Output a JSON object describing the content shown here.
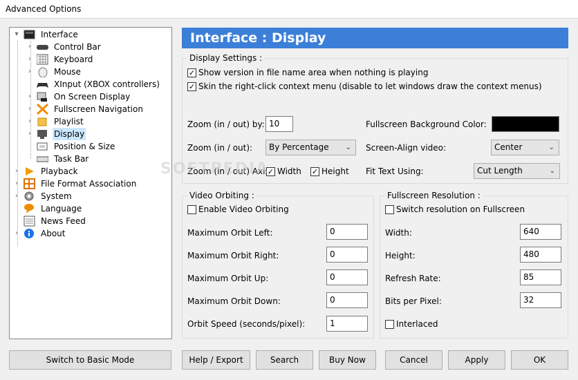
{
  "window": {
    "title": "Advanced Options"
  },
  "tree": [
    {
      "label": "Interface",
      "icon": "interface-icon",
      "expanded": true
    },
    {
      "label": "Control Bar",
      "icon": "control-bar-icon"
    },
    {
      "label": "Keyboard",
      "icon": "keyboard-icon"
    },
    {
      "label": "Mouse",
      "icon": "mouse-icon"
    },
    {
      "label": "XInput (XBOX controllers)",
      "icon": "gamepad-icon"
    },
    {
      "label": "On Screen Display",
      "icon": "osd-icon"
    },
    {
      "label": "Fullscreen Navigation",
      "icon": "fullscreen-nav-icon"
    },
    {
      "label": "Playlist",
      "icon": "playlist-icon"
    },
    {
      "label": "Display",
      "icon": "display-icon",
      "selected": true
    },
    {
      "label": "Position & Size",
      "icon": "position-size-icon"
    },
    {
      "label": "Task Bar",
      "icon": "taskbar-icon"
    },
    {
      "label": "Playback",
      "icon": "playback-icon"
    },
    {
      "label": "File Format Association",
      "icon": "file-format-icon"
    },
    {
      "label": "System",
      "icon": "gear-icon"
    },
    {
      "label": "Language",
      "icon": "language-icon"
    },
    {
      "label": "News Feed",
      "icon": "news-icon"
    },
    {
      "label": "About",
      "icon": "info-icon"
    }
  ],
  "header": {
    "title": "Interface : Display"
  },
  "display_settings": {
    "title": "Display Settings :",
    "show_version": {
      "label": "Show version in file name area when nothing is playing",
      "checked": true
    },
    "skin_context": {
      "label": "Skin the right-click context menu (disable to let windows draw the context menus)",
      "checked": true
    },
    "zoom_by_label": "Zoom (in / out) by:",
    "zoom_by_value": "10",
    "zoom_mode_label": "Zoom (in / out):",
    "zoom_mode_value": "By Percentage",
    "zoom_axis_label": "Zoom (in / out) Axis:",
    "axis_width": {
      "label": "Width",
      "checked": true
    },
    "axis_height": {
      "label": "Height",
      "checked": true
    },
    "bg_color_label": "Fullscreen Background Color:",
    "bg_color_value": "#000000",
    "align_label": "Screen-Align video:",
    "align_value": "Center",
    "fit_text_label": "Fit Text Using:",
    "fit_text_value": "Cut Length"
  },
  "video_orbiting": {
    "title": "Video Orbiting :",
    "enable": {
      "label": "Enable Video Orbiting",
      "checked": false
    },
    "fields": [
      {
        "label": "Maximum Orbit Left:",
        "value": "0"
      },
      {
        "label": "Maximum Orbit Right:",
        "value": "0"
      },
      {
        "label": "Maximum Orbit Up:",
        "value": "0"
      },
      {
        "label": "Maximum Orbit Down:",
        "value": "0"
      },
      {
        "label": "Orbit Speed (seconds/pixel):",
        "value": "1"
      }
    ]
  },
  "fullscreen_resolution": {
    "title": "Fullscreen Resolution :",
    "switch": {
      "label": "Switch resolution on Fullscreen",
      "checked": false
    },
    "fields": [
      {
        "label": "Width:",
        "value": "640"
      },
      {
        "label": "Height:",
        "value": "480"
      },
      {
        "label": "Refresh Rate:",
        "value": "85"
      },
      {
        "label": "Bits per Pixel:",
        "value": "32"
      }
    ],
    "interlaced": {
      "label": "Interlaced",
      "checked": false
    }
  },
  "buttons": {
    "basic_mode": "Switch to Basic Mode",
    "help_export": "Help / Export",
    "search": "Search",
    "buy_now": "Buy Now",
    "cancel": "Cancel",
    "apply": "Apply",
    "ok": "OK"
  },
  "watermark": "SOFTPEDIA"
}
